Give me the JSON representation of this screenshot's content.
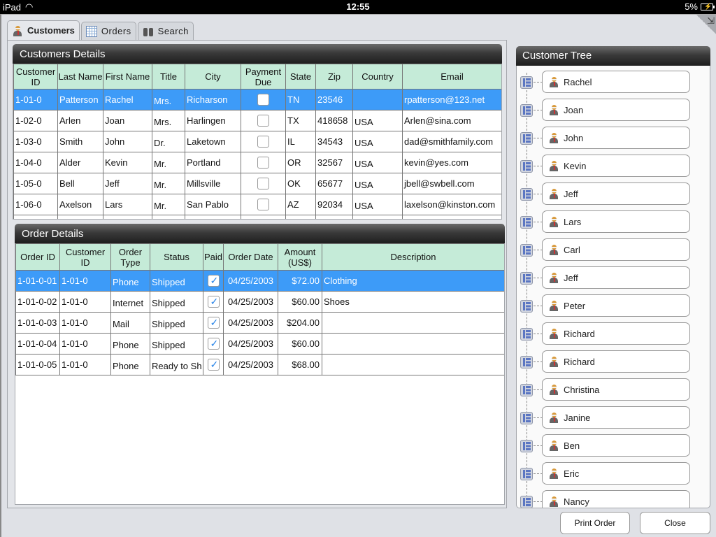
{
  "statusbar": {
    "device": "iPad",
    "time": "12:55",
    "battery": "5%"
  },
  "tabs": [
    {
      "label": "Customers",
      "icon": "person-icon",
      "active": true
    },
    {
      "label": "Orders",
      "icon": "grid-icon",
      "active": false
    },
    {
      "label": "Search",
      "icon": "binoculars-icon",
      "active": false
    }
  ],
  "customers": {
    "title": "Customers Details",
    "columns": [
      "Customer ID",
      "Last Name",
      "First Name",
      "Title",
      "City",
      "Payment Due",
      "State",
      "Zip",
      "Country",
      "Email"
    ],
    "rows": [
      {
        "id": "1-01-0",
        "last": "Patterson",
        "first": "Rachel",
        "title": "Mrs.",
        "city": "Richarson",
        "due": false,
        "state": "TN",
        "zip": "23546",
        "country": "",
        "email": "rpatterson@123.net",
        "selected": true
      },
      {
        "id": "1-02-0",
        "last": "Arlen",
        "first": "Joan",
        "title": "Mrs.",
        "city": "Harlingen",
        "due": false,
        "state": "TX",
        "zip": "418658",
        "country": "USA",
        "email": "Arlen@sina.com"
      },
      {
        "id": "1-03-0",
        "last": "Smith",
        "first": "John",
        "title": "Dr.",
        "city": "Laketown",
        "due": false,
        "state": "IL",
        "zip": "34543",
        "country": "USA",
        "email": "dad@smithfamily.com"
      },
      {
        "id": "1-04-0",
        "last": "Alder",
        "first": "Kevin",
        "title": "Mr.",
        "city": "Portland",
        "due": false,
        "state": "OR",
        "zip": "32567",
        "country": "USA",
        "email": "kevin@yes.com"
      },
      {
        "id": "1-05-0",
        "last": "Bell",
        "first": "Jeff",
        "title": "Mr.",
        "city": "Millsville",
        "due": false,
        "state": "OK",
        "zip": "65677",
        "country": "USA",
        "email": "jbell@swbell.com"
      },
      {
        "id": "1-06-0",
        "last": "Axelson",
        "first": "Lars",
        "title": "Mr.",
        "city": "San Pablo",
        "due": false,
        "state": "AZ",
        "zip": "92034",
        "country": "USA",
        "email": "laxelson@kinston.com"
      }
    ]
  },
  "orders": {
    "title": "Order Details",
    "columns": [
      "Order ID",
      "Customer ID",
      "Order Type",
      "Status",
      "Paid",
      "Order Date",
      "Amount (US$)",
      "Description"
    ],
    "rows": [
      {
        "id": "1-01-0-01",
        "cust": "1-01-0",
        "type": "Phone",
        "status": "Shipped",
        "paid": true,
        "date": "04/25/2003",
        "amount": "$72.00",
        "desc": "Clothing",
        "selected": true
      },
      {
        "id": "1-01-0-02",
        "cust": "1-01-0",
        "type": "Internet",
        "status": "Shipped",
        "paid": true,
        "date": "04/25/2003",
        "amount": "$60.00",
        "desc": "Shoes"
      },
      {
        "id": "1-01-0-03",
        "cust": "1-01-0",
        "type": "Mail",
        "status": "Shipped",
        "paid": true,
        "date": "04/25/2003",
        "amount": "$204.00",
        "desc": ""
      },
      {
        "id": "1-01-0-04",
        "cust": "1-01-0",
        "type": "Phone",
        "status": "Shipped",
        "paid": true,
        "date": "04/25/2003",
        "amount": "$60.00",
        "desc": ""
      },
      {
        "id": "1-01-0-05",
        "cust": "1-01-0",
        "type": "Phone",
        "status": "Ready to Sh",
        "paid": true,
        "date": "04/25/2003",
        "amount": "$68.00",
        "desc": ""
      }
    ]
  },
  "tree": {
    "title": "Customer Tree",
    "items": [
      "Rachel",
      "Joan",
      "John",
      "Kevin",
      "Jeff",
      "Lars",
      "Carl",
      "Jeff",
      "Peter",
      "Richard",
      "Richard",
      "Christina",
      "Janine",
      "Ben",
      "Eric",
      "Nancy"
    ]
  },
  "buttons": {
    "print": "Print Order",
    "close": "Close"
  }
}
